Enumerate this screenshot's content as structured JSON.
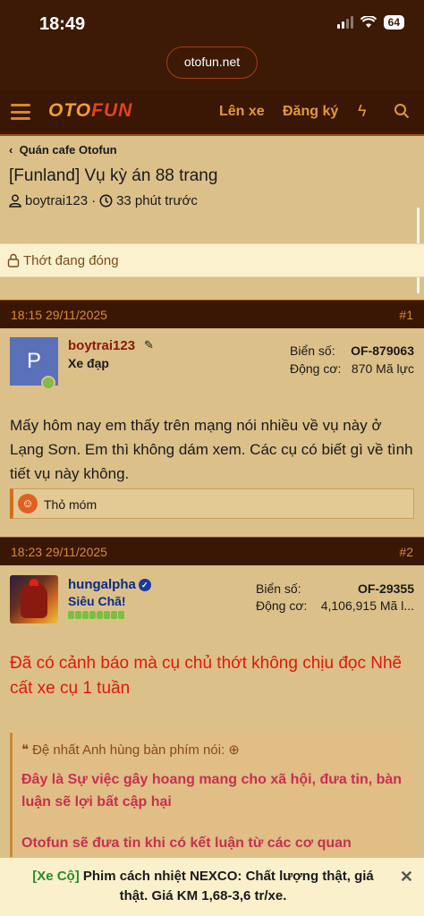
{
  "status": {
    "time": "18:49",
    "battery": "64"
  },
  "browser": {
    "url": "otofun.net"
  },
  "nav": {
    "logo_left": "OTO",
    "logo_right": "FUN",
    "login": "Lên xe",
    "register": "Đăng ký"
  },
  "thread": {
    "breadcrumb": "Quán cafe Otofun",
    "title": "[Funland] Vụ kỳ án 88 trang",
    "author": "boytrai123",
    "separator": "·",
    "time": "33 phút trước",
    "locked": "Thớt đang đóng"
  },
  "posts": [
    {
      "datetime": "18:15 29/11/2025",
      "number": "#1",
      "avatar_letter": "P",
      "author": "boytrai123",
      "rank": "Xe đạp",
      "plate_label": "Biển số:",
      "plate": "OF-879063",
      "engine_label": "Động cơ:",
      "engine": "870 Mã lực",
      "body": "Mấy hôm nay em thấy trên mạng nói nhiều về vụ này ở Lạng Sơn. Em thì không dám xem. Các cụ có biết gì về tình tiết vụ này không.",
      "reaction": "Thỏ móm"
    },
    {
      "datetime": "18:23 29/11/2025",
      "number": "#2",
      "author": "hungalpha",
      "rank": "Siêu Chã!",
      "plate_label": "Biển số:",
      "plate": "OF-29355",
      "engine_label": "Động cơ:",
      "engine": "4,106,915 Mã l...",
      "body": "Đã có cảnh báo mà cụ chủ thớt không chịu đọc Nhẽ cất xe cụ 1 tuần",
      "quote_author": "Đệ nhất Anh hùng bàn phím nói:",
      "quote_p1": "Đây là Sự việc gây hoang mang cho xã hội, đưa tin, bàn luận sẽ lợi bất cập hại",
      "quote_p2": "Otofun sẽ đưa tin khi có kết luận từ các cơ quan"
    }
  ],
  "ad": {
    "tag": "[Xe Cộ]",
    "text": " Phim cách nhiệt NEXCO: Chất lượng thật, giá thật. Giá KM 1,68-3,6 tr/xe.",
    "close": "✕"
  }
}
